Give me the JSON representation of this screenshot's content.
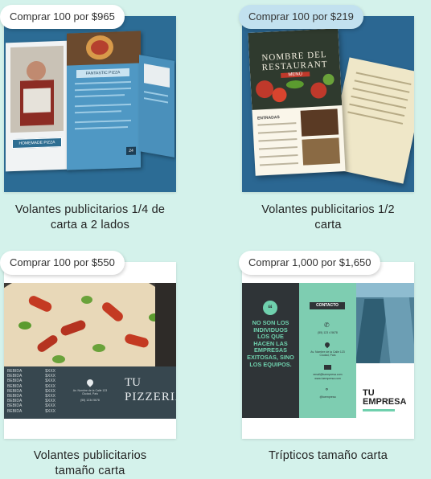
{
  "products": [
    {
      "badge": "Comprar 100 por $965",
      "title_line1": "Volantes publicitarios 1/4 de",
      "title_line2": "carta a 2 lados",
      "mock": {
        "header": "FANTASTIC PIZZA",
        "label": "HOMEMADE PIZZA",
        "page_no": "24"
      }
    },
    {
      "badge": "Comprar 100 por $219",
      "title_line1": "Volantes publicitarios 1/2",
      "title_line2": "carta",
      "mock": {
        "title1": "NOMBRE DEL",
        "title2": "RESTAURANT",
        "ribbon": "MENÚ",
        "section": "ENTRADAS"
      }
    },
    {
      "badge": "Comprar 100 por $550",
      "title_line1": "Volantes publicitarios",
      "title_line2": "tamaño carta",
      "mock": {
        "brand1": "TU",
        "brand2": "PIZZERIA",
        "menu_item": "BEBIDA",
        "menu_price": "$XXX",
        "address": "Av. Nombre de la Calle 123 Ciudad, País",
        "phone": "(55) 1234 5678"
      }
    },
    {
      "badge": "Comprar 1,000 por $1,650",
      "title_line1": "Trípticos tamaño carta",
      "title_line2": "",
      "mock": {
        "quote": "NO SON LOS INDIVIDUOS LOS QUE HACEN LAS EMPRESAS EXITOSAS, SINO LOS EQUIPOS.",
        "contact_label": "CONTACTO",
        "phone": "(55) 123 4 5678",
        "address": "Av. Nombre de la Calle 123 Ciudad, País",
        "email": "email@tuempresa.com",
        "web": "www.tuempresa.com",
        "social": "@tuempresa",
        "brand1": "TU",
        "brand2": "EMPRESA"
      }
    }
  ]
}
